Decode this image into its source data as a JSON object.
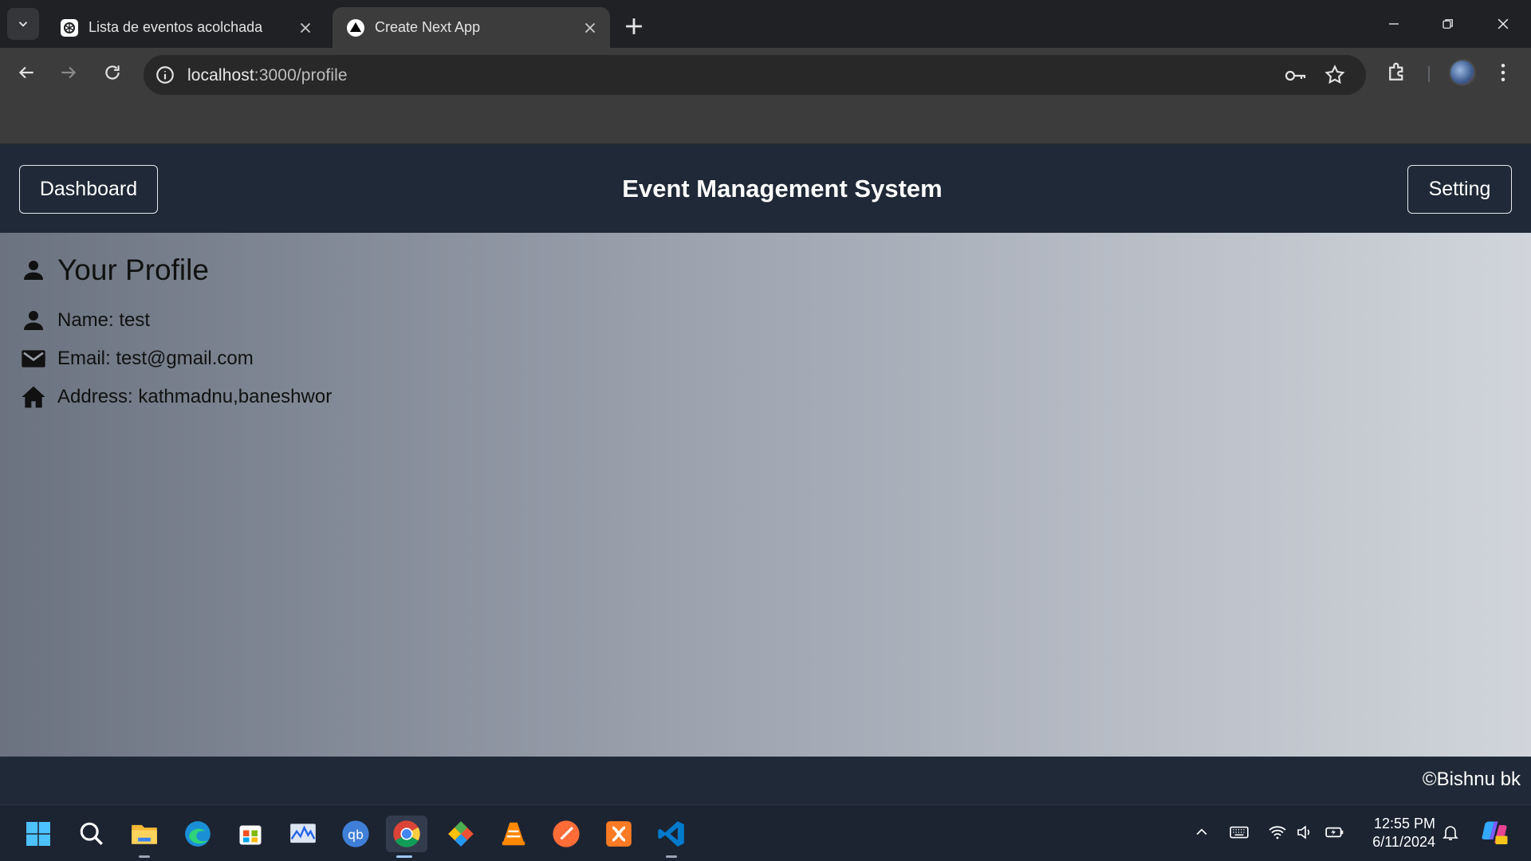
{
  "browser": {
    "tabs": [
      {
        "title": "Lista de eventos acolchada",
        "icon": "chatgpt-icon",
        "active": false
      },
      {
        "title": "Create Next App",
        "icon": "nextjs-icon",
        "active": true
      }
    ],
    "url_host": "localhost",
    "url_path": ":3000/profile"
  },
  "header": {
    "dashboard_label": "Dashboard",
    "title": "Event Management System",
    "setting_label": "Setting"
  },
  "profile": {
    "heading": "Your Profile",
    "name_line": "Name: test",
    "email_line": "Email: test@gmail.com",
    "address_line": "Address: kathmadnu,baneshwor"
  },
  "footer": {
    "copyright": "©Bishnu bk"
  },
  "taskbar": {
    "apps": [
      "start-icon",
      "search-icon",
      "file-explorer-icon",
      "edge-icon",
      "store-icon",
      "monitor-app-icon",
      "qbittorrent-icon",
      "chrome-icon",
      "git-icon",
      "vlc-icon",
      "postman-icon",
      "xampp-icon",
      "vscode-icon"
    ],
    "time": "12:55 PM",
    "date": "6/11/2024"
  },
  "colors": {
    "header_bg": "#1f2937",
    "content_gradient_start": "#6b7280",
    "content_gradient_end": "#d1d5db",
    "browser_frame": "#202124"
  }
}
